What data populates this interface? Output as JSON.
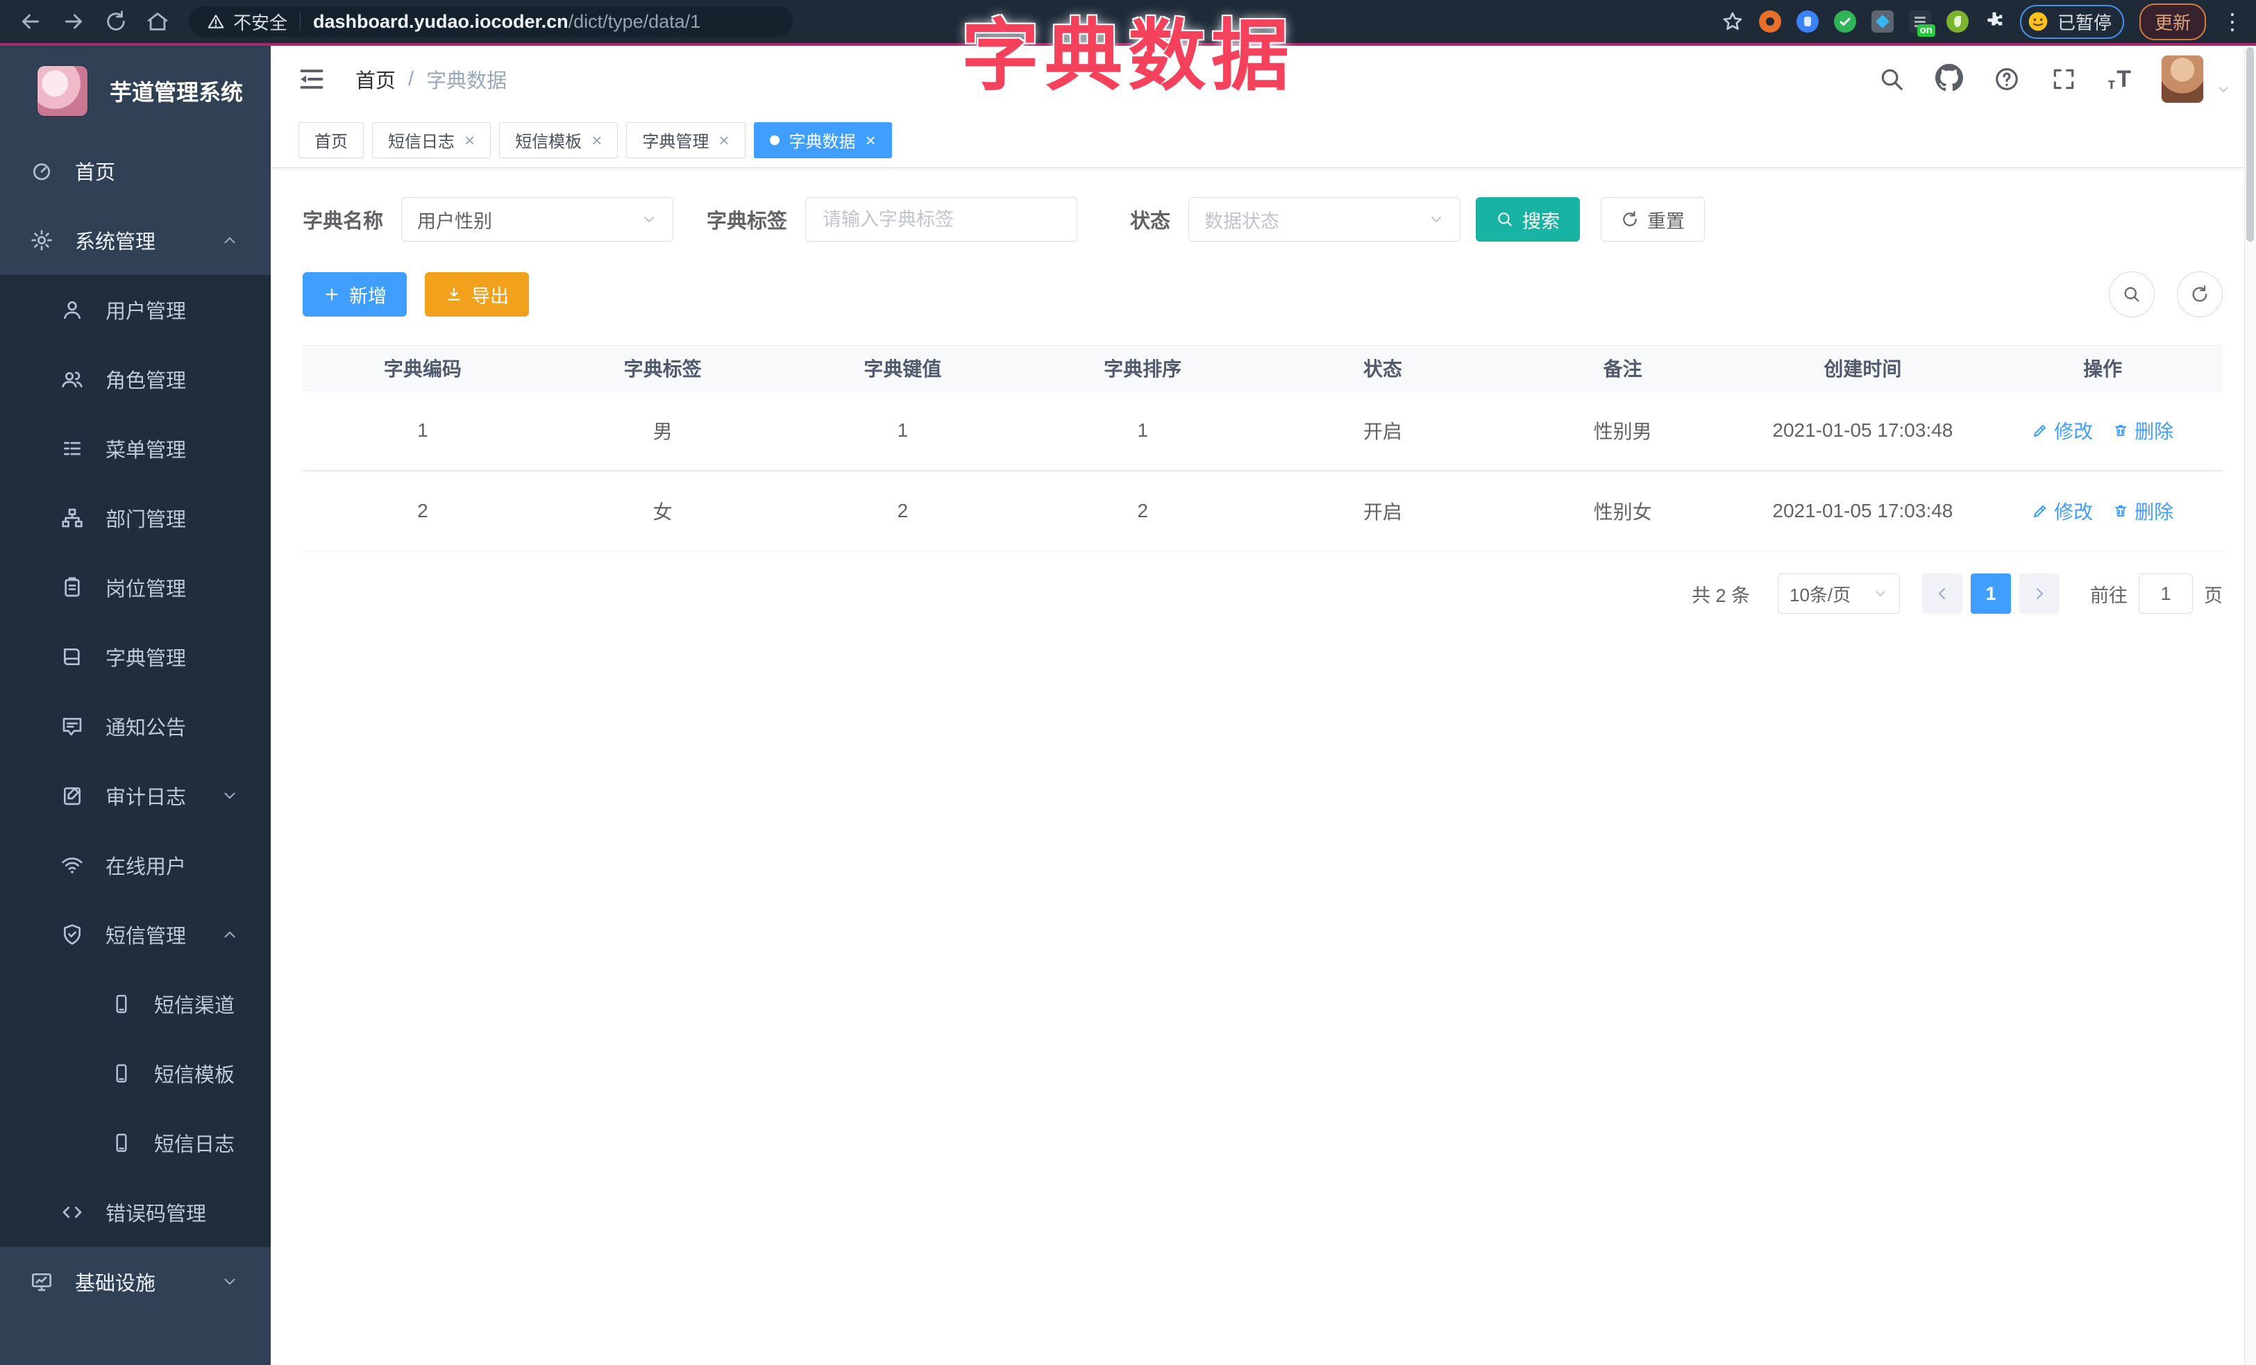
{
  "colors": {
    "primary": "#409eff",
    "success": "#18b3a3",
    "warning": "#f2a11c",
    "annotation": "#f4415c",
    "sidebar_bg": "#304156",
    "submenu_bg": "#1f2d3d"
  },
  "browser": {
    "security_label": "不安全",
    "url_domain": "dashboard.yudao.iocoder.cn",
    "url_path": "/dict/type/data/1",
    "extension_on_badge": "on",
    "paused_label": "已暂停",
    "update_label": "更新"
  },
  "annotation": {
    "text": "字典数据"
  },
  "sidebar": {
    "logo_title": "芋道管理系统",
    "items": [
      {
        "label": "首页"
      },
      {
        "label": "系统管理"
      },
      {
        "label": "用户管理"
      },
      {
        "label": "角色管理"
      },
      {
        "label": "菜单管理"
      },
      {
        "label": "部门管理"
      },
      {
        "label": "岗位管理"
      },
      {
        "label": "字典管理"
      },
      {
        "label": "通知公告"
      },
      {
        "label": "审计日志"
      },
      {
        "label": "在线用户"
      },
      {
        "label": "短信管理"
      },
      {
        "label": "短信渠道"
      },
      {
        "label": "短信模板"
      },
      {
        "label": "短信日志"
      },
      {
        "label": "错误码管理"
      },
      {
        "label": "基础设施"
      }
    ]
  },
  "navbar": {
    "breadcrumb_home": "首页",
    "breadcrumb_sep": "/",
    "breadcrumb_current": "字典数据"
  },
  "tabs": [
    {
      "label": "首页"
    },
    {
      "label": "短信日志"
    },
    {
      "label": "短信模板"
    },
    {
      "label": "字典管理"
    },
    {
      "label": "字典数据"
    }
  ],
  "filters": {
    "name_label": "字典名称",
    "name_value": "用户性别",
    "tag_label": "字典标签",
    "tag_placeholder": "请输入字典标签",
    "status_label": "状态",
    "status_placeholder": "数据状态",
    "search_label": "搜索",
    "reset_label": "重置"
  },
  "toolbar": {
    "add_label": "新增",
    "export_label": "导出"
  },
  "table": {
    "columns": [
      "字典编码",
      "字典标签",
      "字典键值",
      "字典排序",
      "状态",
      "备注",
      "创建时间",
      "操作"
    ],
    "rows": [
      {
        "code": "1",
        "label": "男",
        "value": "1",
        "sort": "1",
        "status": "开启",
        "remark": "性别男",
        "created": "2021-01-05 17:03:48"
      },
      {
        "code": "2",
        "label": "女",
        "value": "2",
        "sort": "2",
        "status": "开启",
        "remark": "性别女",
        "created": "2021-01-05 17:03:48"
      }
    ],
    "edit_label": "修改",
    "delete_label": "删除"
  },
  "pagination": {
    "total": "共 2 条",
    "page_size": "10条/页",
    "current_page": "1",
    "goto_label": "前往",
    "goto_value": "1",
    "page_unit": "页"
  }
}
